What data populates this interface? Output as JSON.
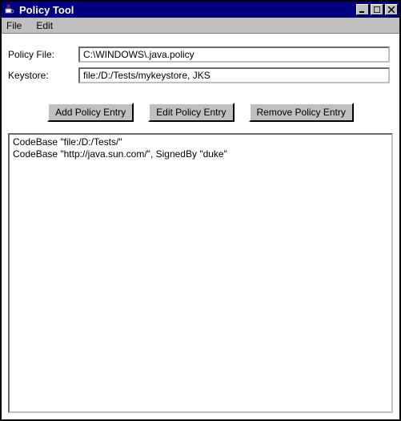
{
  "window": {
    "title": "Policy Tool"
  },
  "menubar": {
    "file": "File",
    "edit": "Edit"
  },
  "form": {
    "policy_file_label": "Policy File:",
    "policy_file_value": "C:\\WINDOWS\\.java.policy",
    "keystore_label": "Keystore:",
    "keystore_value": "file:/D:/Tests/mykeystore, JKS"
  },
  "buttons": {
    "add": "Add Policy Entry",
    "edit": "Edit Policy Entry",
    "remove": "Remove Policy Entry"
  },
  "entries": [
    "CodeBase \"file:/D:/Tests/\"",
    "CodeBase \"http://java.sun.com/\", SignedBy \"duke\""
  ]
}
